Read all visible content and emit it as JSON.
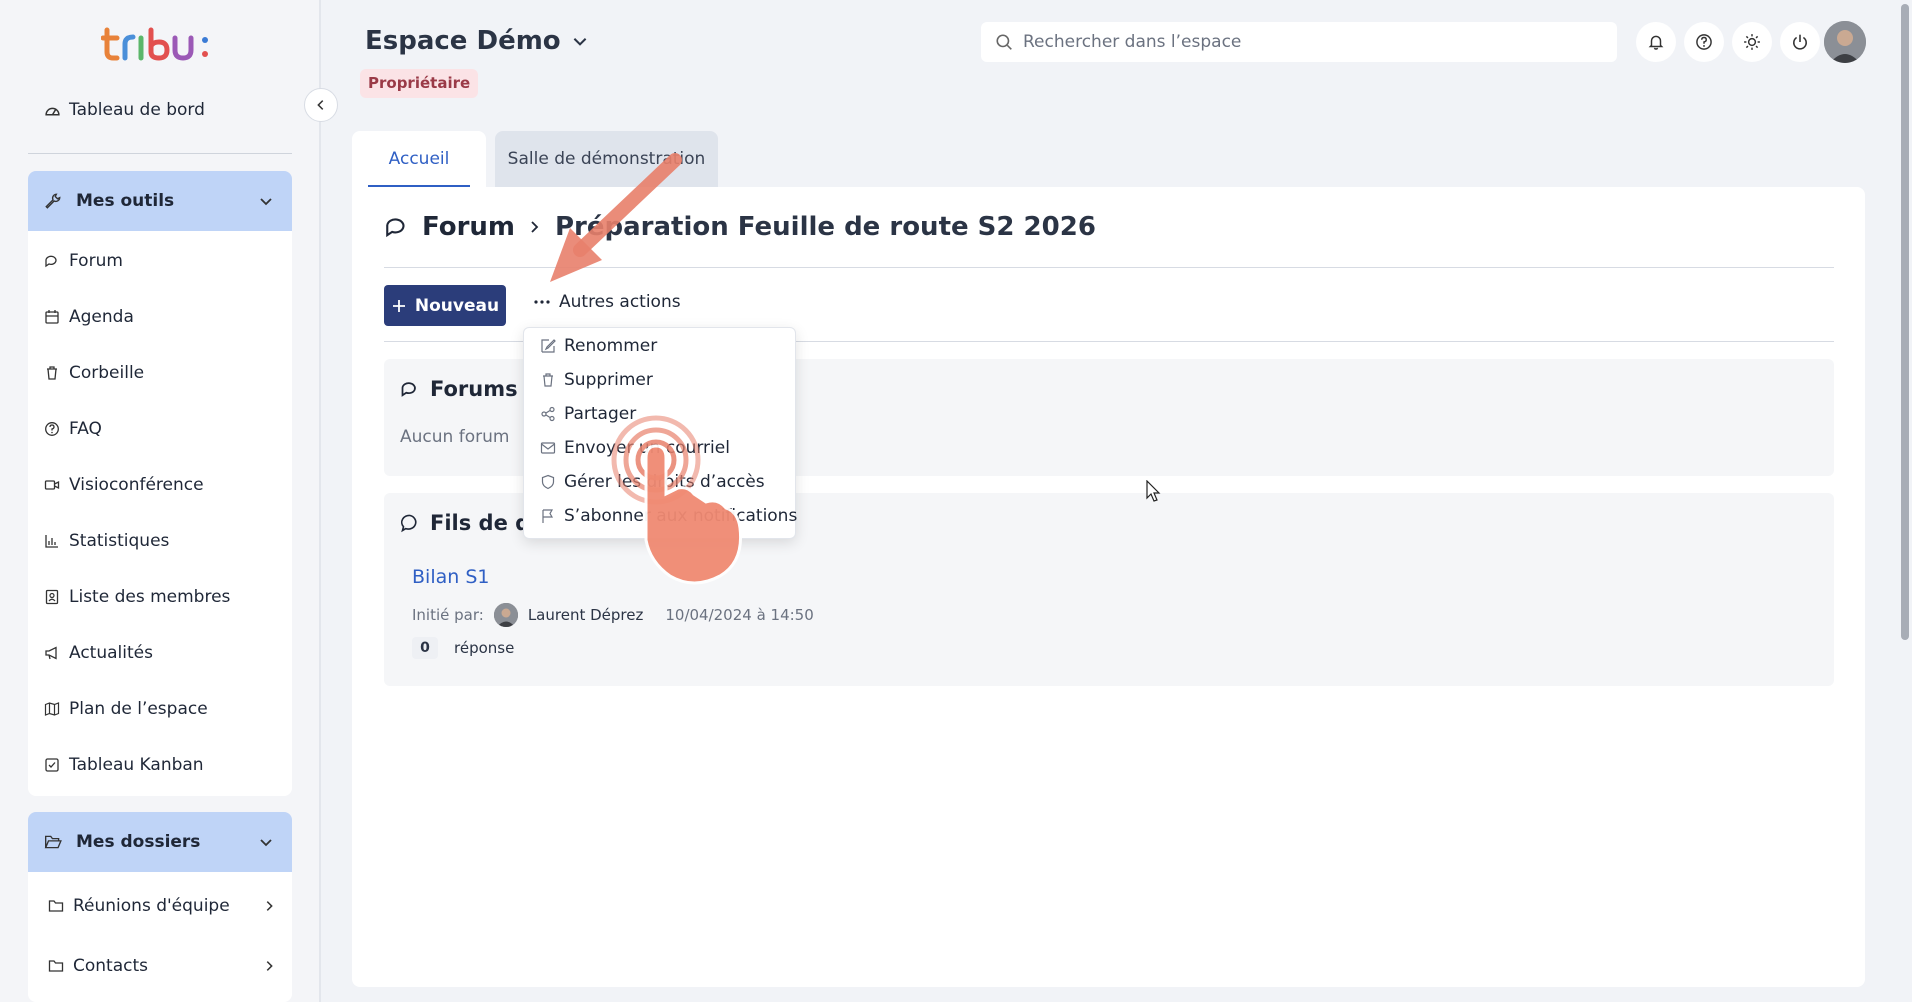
{
  "sidebar": {
    "logo_text": "tribu:",
    "dashboard_label": "Tableau de bord",
    "tools_section": {
      "label": "Mes outils",
      "items": [
        {
          "label": "Forum",
          "icon": "forum-icon"
        },
        {
          "label": "Agenda",
          "icon": "calendar-icon"
        },
        {
          "label": "Corbeille",
          "icon": "trash-icon"
        },
        {
          "label": "FAQ",
          "icon": "help-icon"
        },
        {
          "label": "Visioconférence",
          "icon": "video-icon"
        },
        {
          "label": "Statistiques",
          "icon": "stats-icon"
        },
        {
          "label": "Liste des membres",
          "icon": "members-icon"
        },
        {
          "label": "Actualités",
          "icon": "megaphone-icon"
        },
        {
          "label": "Plan de l’espace",
          "icon": "map-icon"
        },
        {
          "label": "Tableau Kanban",
          "icon": "kanban-icon"
        }
      ]
    },
    "folders_section": {
      "label": "Mes dossiers",
      "items": [
        {
          "label": "Réunions d'équipe"
        },
        {
          "label": "Contacts"
        }
      ]
    }
  },
  "header": {
    "space_title": "Espace Démo",
    "role_badge": "Propriétaire",
    "search_placeholder": "Rechercher dans l’espace"
  },
  "tabs": [
    {
      "label": "Accueil",
      "active": true
    },
    {
      "label": "Salle de démonstration",
      "active": false
    }
  ],
  "breadcrumb": {
    "root": "Forum",
    "current": "Préparation Feuille de route S2 2026"
  },
  "toolbar": {
    "new_label": "Nouveau",
    "more_label": "Autres actions"
  },
  "dropdown": {
    "items": [
      {
        "label": "Renommer",
        "icon": "edit-icon"
      },
      {
        "label": "Supprimer",
        "icon": "trash-icon"
      },
      {
        "label": "Partager",
        "icon": "share-icon"
      },
      {
        "label": "Envoyer un courriel",
        "icon": "mail-icon"
      },
      {
        "label": "Gérer les droits d’accès",
        "icon": "shield-icon"
      },
      {
        "label": "S’abonner aux notifications",
        "icon": "flag-icon"
      }
    ]
  },
  "forums_panel": {
    "title": "Forums",
    "empty_text": "Aucun forum"
  },
  "threads_panel": {
    "title": "Fils de discussion",
    "thread": {
      "title": "Bilan S1",
      "initiated_label": "Initié par:",
      "author": "Laurent Déprez",
      "date": "10/04/2024 à 14:50",
      "reply_count": "0",
      "reply_label": "réponse"
    }
  },
  "colors": {
    "accent": "#2f5fc4",
    "primary_button": "#2b3d7a",
    "section_header": "#bfd4f7",
    "annotation": "#e8806b"
  }
}
